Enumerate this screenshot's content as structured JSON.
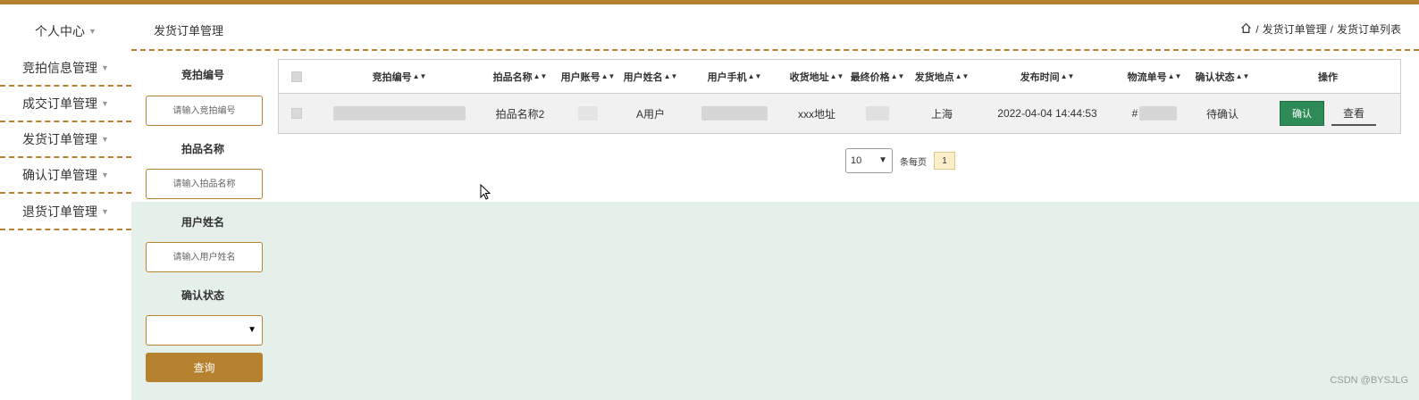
{
  "sidebar": {
    "items": [
      {
        "label": "个人中心"
      },
      {
        "label": "竞拍信息管理"
      },
      {
        "label": "成交订单管理"
      },
      {
        "label": "发货订单管理"
      },
      {
        "label": "确认订单管理"
      },
      {
        "label": "退货订单管理"
      }
    ]
  },
  "header": {
    "title": "发货订单管理",
    "breadcrumb": [
      "发货订单管理",
      "发货订单列表"
    ],
    "sep": "/"
  },
  "search": {
    "auction_no_label": "竞拍编号",
    "auction_no_placeholder": "请输入竞拍编号",
    "item_name_label": "拍品名称",
    "item_name_placeholder": "请输入拍品名称",
    "user_name_label": "用户姓名",
    "user_name_placeholder": "请输入用户姓名",
    "confirm_status_label": "确认状态",
    "confirm_status_value": "",
    "query_label": "查询"
  },
  "table": {
    "headers": [
      "竞拍编号",
      "拍品名称",
      "用户账号",
      "用户姓名",
      "用户手机",
      "收货地址",
      "最终价格",
      "发货地点",
      "发布时间",
      "物流单号",
      "确认状态",
      "操作"
    ],
    "rows": [
      {
        "item_name": "拍品名称2",
        "user_name": "A用户",
        "address": "xxx地址",
        "ship_place": "上海",
        "publish_time": "2022-04-04 14:44:53",
        "logistics_prefix": "#",
        "confirm_status": "待确认",
        "confirm_btn": "确认",
        "view_btn": "查看"
      }
    ]
  },
  "pager": {
    "page_size": "10",
    "per_page_label": "条每页",
    "current_page": "1"
  },
  "watermark": "CSDN @BYSJLG",
  "colors": {
    "accent": "#b7822f",
    "green": "#2e8b57",
    "bg_green": "#e5f0ea"
  }
}
